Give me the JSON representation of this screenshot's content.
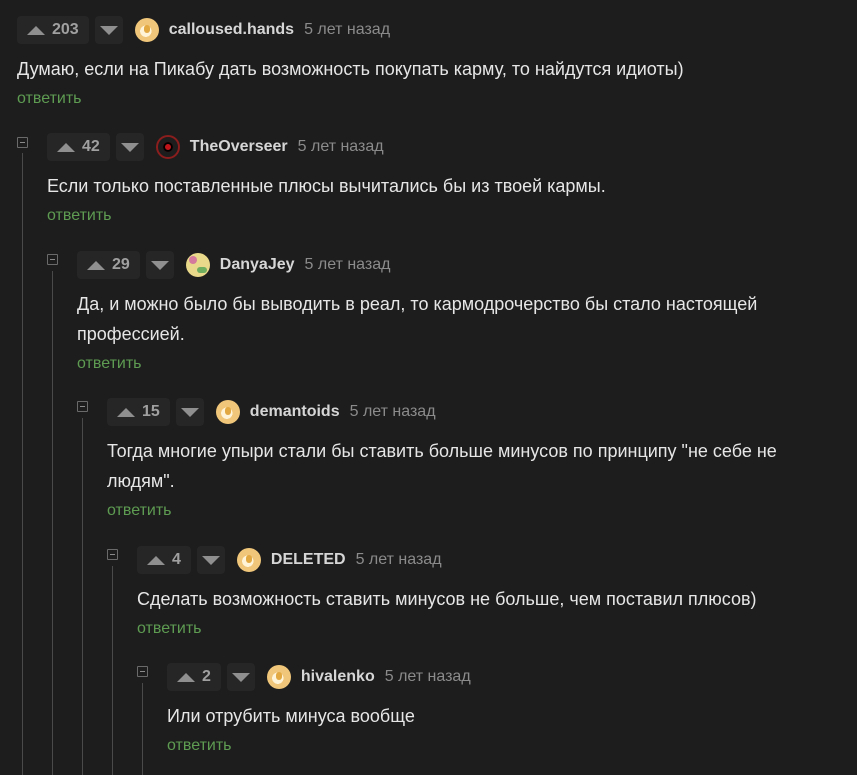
{
  "comments": [
    {
      "rating": "203",
      "author": "calloused.hands",
      "time": "5 лет назад",
      "text": "Думаю, если на Пикабу дать возможность покупать карму, то найдутся идиоты)",
      "reply": "ответить"
    },
    {
      "rating": "42",
      "author": "TheOverseer",
      "time": "5 лет назад",
      "text": "Если только поставленные плюсы вычитались бы из твоей кармы.",
      "reply": "ответить"
    },
    {
      "rating": "29",
      "author": "DanyaJey",
      "time": "5 лет назад",
      "text": "Да, и можно было бы выводить в реал, то кармодрочерство бы стало настоящей профессией.",
      "reply": "ответить"
    },
    {
      "rating": "15",
      "author": "demantoids",
      "time": "5 лет назад",
      "text": "Тогда многие упыри стали бы ставить больше минусов по принципу \"не себе не людям\".",
      "reply": "ответить"
    },
    {
      "rating": "4",
      "author": "DELETED",
      "time": "5 лет назад",
      "text": "Сделать возможность ставить минусов не больше, чем поставил плюсов)",
      "reply": "ответить"
    },
    {
      "rating": "2",
      "author": "hivalenko",
      "time": "5 лет назад",
      "text": "Или отрубить минуса вообще",
      "reply": "ответить"
    }
  ]
}
